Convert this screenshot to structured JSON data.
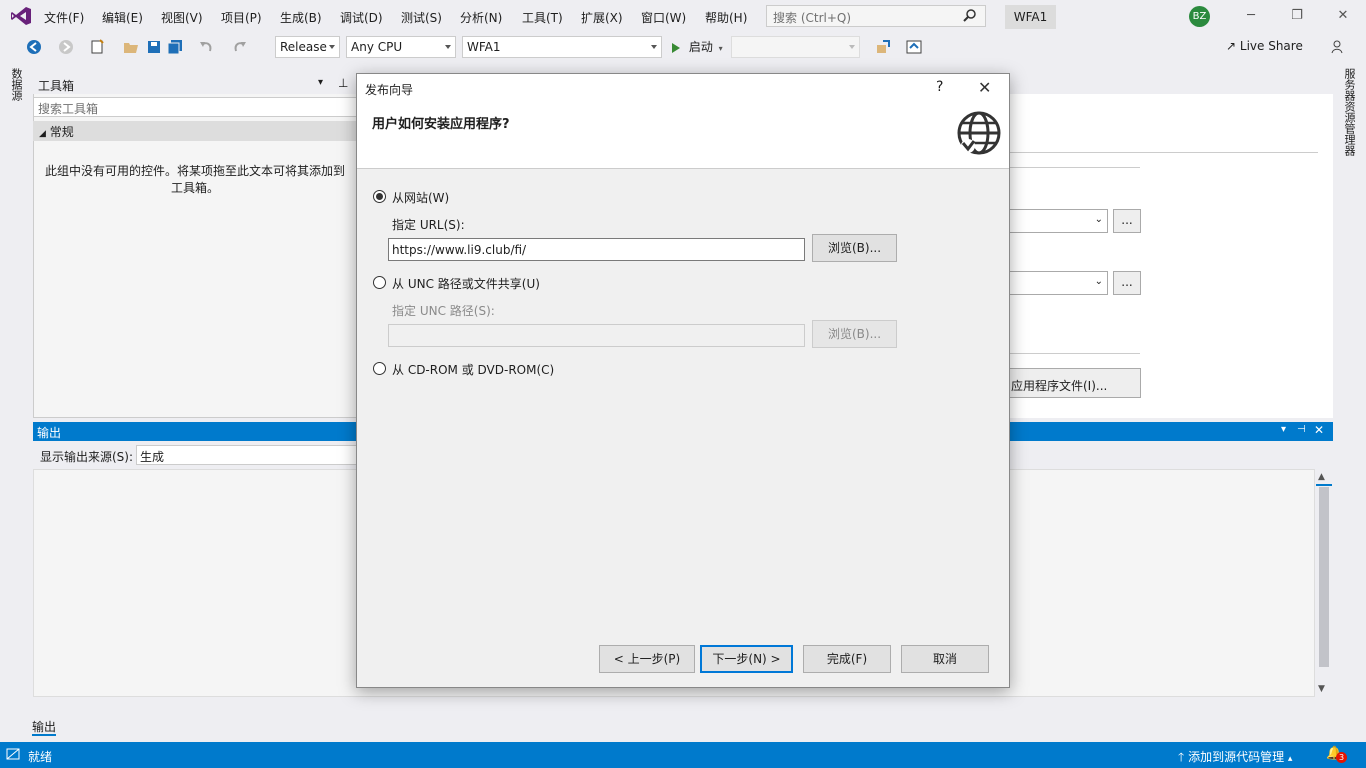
{
  "menubar": {
    "items": [
      "文件(F)",
      "编辑(E)",
      "视图(V)",
      "项目(P)",
      "生成(B)",
      "调试(D)",
      "测试(S)",
      "分析(N)",
      "工具(T)",
      "扩展(X)",
      "窗口(W)",
      "帮助(H)"
    ],
    "search_placeholder": "搜索 (Ctrl+Q)",
    "solution_name": "WFA1",
    "user_initials": "BZ"
  },
  "toolbar": {
    "config": "Release",
    "platform": "Any CPU",
    "project": "WFA1",
    "start_label": "启动",
    "liveshare_label": "Live Share"
  },
  "left_vtab": "数据源",
  "right_vtab": "服务器资源管理器",
  "toolbox": {
    "title": "工具箱",
    "search_placeholder": "搜索工具箱",
    "group": "常规",
    "empty_text": "此组中没有可用的控件。将某项拖至此文本可将其添加到工具箱。"
  },
  "doc": {
    "app_files_label": "应用程序文件(I)...",
    "ellipsis": "..."
  },
  "output": {
    "title": "输出",
    "source_label": "显示输出来源(S):",
    "source_value": "生成",
    "tab_label": "输出"
  },
  "statusbar": {
    "text": "就绪",
    "source_control": "添加到源代码管理",
    "notifications": "3"
  },
  "dialog": {
    "title": "发布向导",
    "help": "?",
    "close": "✕",
    "question": "用户如何安装应用程序?",
    "option_web": "从网站(W)",
    "url_label": "指定 URL(S):",
    "url_value": "https://www.li9.club/fi/",
    "browse_label": "浏览(B)...",
    "option_unc": "从 UNC 路径或文件共享(U)",
    "unc_label": "指定 UNC 路径(S):",
    "unc_value": "",
    "browse_unc_label": "浏览(B)...",
    "option_cd": "从 CD-ROM 或 DVD-ROM(C)",
    "prev_label": "< 上一步(P)",
    "next_label": "下一步(N) >",
    "finish_label": "完成(F)",
    "cancel_label": "取消"
  }
}
